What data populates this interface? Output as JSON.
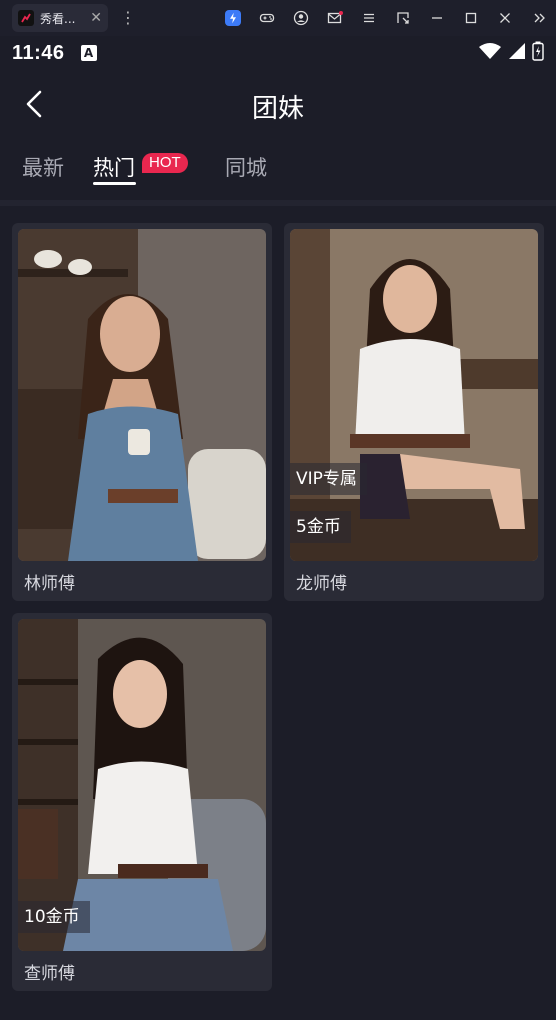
{
  "chrome": {
    "tab_title": "秀看...",
    "close_glyph": "✕",
    "menu_glyph": "⋮",
    "icons": [
      "bolt-icon",
      "gamepad-icon",
      "account-icon",
      "mail-icon",
      "hamburger-menu-icon",
      "resize-icon",
      "minimize-icon",
      "maximize-icon",
      "close-window-icon",
      "expand-icon"
    ]
  },
  "status_bar": {
    "time": "11:46",
    "notification_icon": "A"
  },
  "header": {
    "title": "团妹"
  },
  "tabs": [
    {
      "label": "最新"
    },
    {
      "label": "热门"
    },
    {
      "label": "同城"
    }
  ],
  "hot_badge": "HOT",
  "cards": [
    {
      "name": "林师傅"
    },
    {
      "name": "龙师傅",
      "vip": "VIP专属",
      "price": "5金币"
    },
    {
      "name": "查师傅",
      "price": "10金币"
    }
  ],
  "colors": {
    "background": "#1c1d28",
    "card": "#2a2b36",
    "accent": "#e9274f"
  }
}
